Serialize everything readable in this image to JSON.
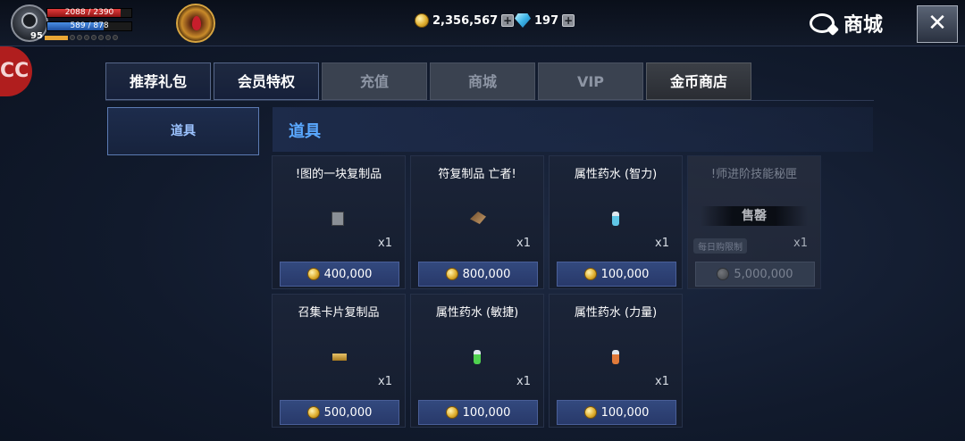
{
  "player": {
    "level": "95",
    "hp_text": "2088 / 2390",
    "hp_fraction": 0.8736,
    "mp_text": "589 / 878",
    "mp_fraction": 0.6708
  },
  "currency": {
    "gold": "2,356,567",
    "diamonds": "197"
  },
  "header": {
    "title": "商城",
    "side_badge": "CC"
  },
  "tabs": [
    {
      "label": "推荐礼包",
      "state": "normal"
    },
    {
      "label": "会员特权",
      "state": "normal"
    },
    {
      "label": "充值",
      "state": "disabled"
    },
    {
      "label": "商城",
      "state": "disabled"
    },
    {
      "label": "VIP",
      "state": "disabled"
    },
    {
      "label": "金币商店",
      "state": "active"
    }
  ],
  "category": {
    "label": "道具"
  },
  "panel": {
    "title": "道具"
  },
  "items": [
    {
      "name": "!图的一块复制品",
      "qty": "x1",
      "price": "400,000",
      "icon": "stone-fragment-icon",
      "sold_out": false
    },
    {
      "name": "符复制品  亡者!",
      "qty": "x1",
      "price": "800,000",
      "icon": "feather-icon",
      "sold_out": false
    },
    {
      "name": "属性药水 (智力)",
      "qty": "x1",
      "price": "100,000",
      "icon": "blue-potion-icon",
      "sold_out": false
    },
    {
      "name": "!师进阶技能秘匣",
      "qty": "x1",
      "price": "5,000,000",
      "icon": "skill-box-icon",
      "sold_out": true,
      "sold_out_label": "售罄",
      "limit_label": "每日购限制"
    },
    {
      "name": "召集卡片复制品",
      "qty": "x1",
      "price": "500,000",
      "icon": "card-icon",
      "sold_out": false
    },
    {
      "name": "属性药水 (敏捷)",
      "qty": "x1",
      "price": "100,000",
      "icon": "green-potion-icon",
      "sold_out": false
    },
    {
      "name": "属性药水 (力量)",
      "qty": "x1",
      "price": "100,000",
      "icon": "orange-potion-icon",
      "sold_out": false
    }
  ],
  "colors": {
    "accent_blue": "#5aa8ff",
    "price_button": "#33497e",
    "hp_red": "#e23b3b",
    "mp_blue": "#4b8fe6"
  }
}
